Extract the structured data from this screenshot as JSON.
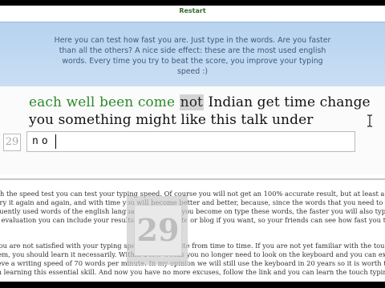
{
  "header": {
    "restart_label": "Restart"
  },
  "info": {
    "line1": "Here you can test how fast you are. Just type in the words. Are you faster",
    "line2": "than all the others? A nice side effect: these are the most used english",
    "line3": "words. Every time you try to beat the score, you improve your typing",
    "line4": "speed :)"
  },
  "words": {
    "typed": "each well been come",
    "current": "not",
    "upcoming_line1": "Indian get time change",
    "line2": "you something might like this talk under"
  },
  "timer": {
    "value": "29"
  },
  "input": {
    "value": "no"
  },
  "score_overlay": {
    "value": "29"
  },
  "article": {
    "p1_l1": "ith the speed test you can test your typing speed. Of course you will not get an 100% accurate result, but at least a clue where y",
    "p1_l2": "Try it again and again, and with time you will become better and better, because, since the words that you need to type, are the m",
    "p1_l3": "quently used words of the english language, the faster you become on type these words, the faster you will also type ordinary texts.",
    "p1_l4": "e evaluation you can include your results in your website or blog if you want, so your friends can see how fast you type.",
    "p2_l1": "you are not satisfied with your typing speed, visit our site from time to time. If you are not yet familiar with the touch typ",
    "p2_l2": "tem, you should learn it necessarily. Within a few weeks you no longer need to look on the keyboard and you can exte",
    "p2_l3": "ieve a writing speed of 70 words per minute. In my opinion we will still use the keyboard in 20 years so it is worth the time yo",
    "p2_l4": "in learning this essential skill. And now you have no more excuses, follow the link and you can learn the touch typing syste"
  },
  "colors": {
    "typed_word": "#2c8a2c",
    "info_bg": "#c0d8f1",
    "restart": "#2e6b2e"
  }
}
